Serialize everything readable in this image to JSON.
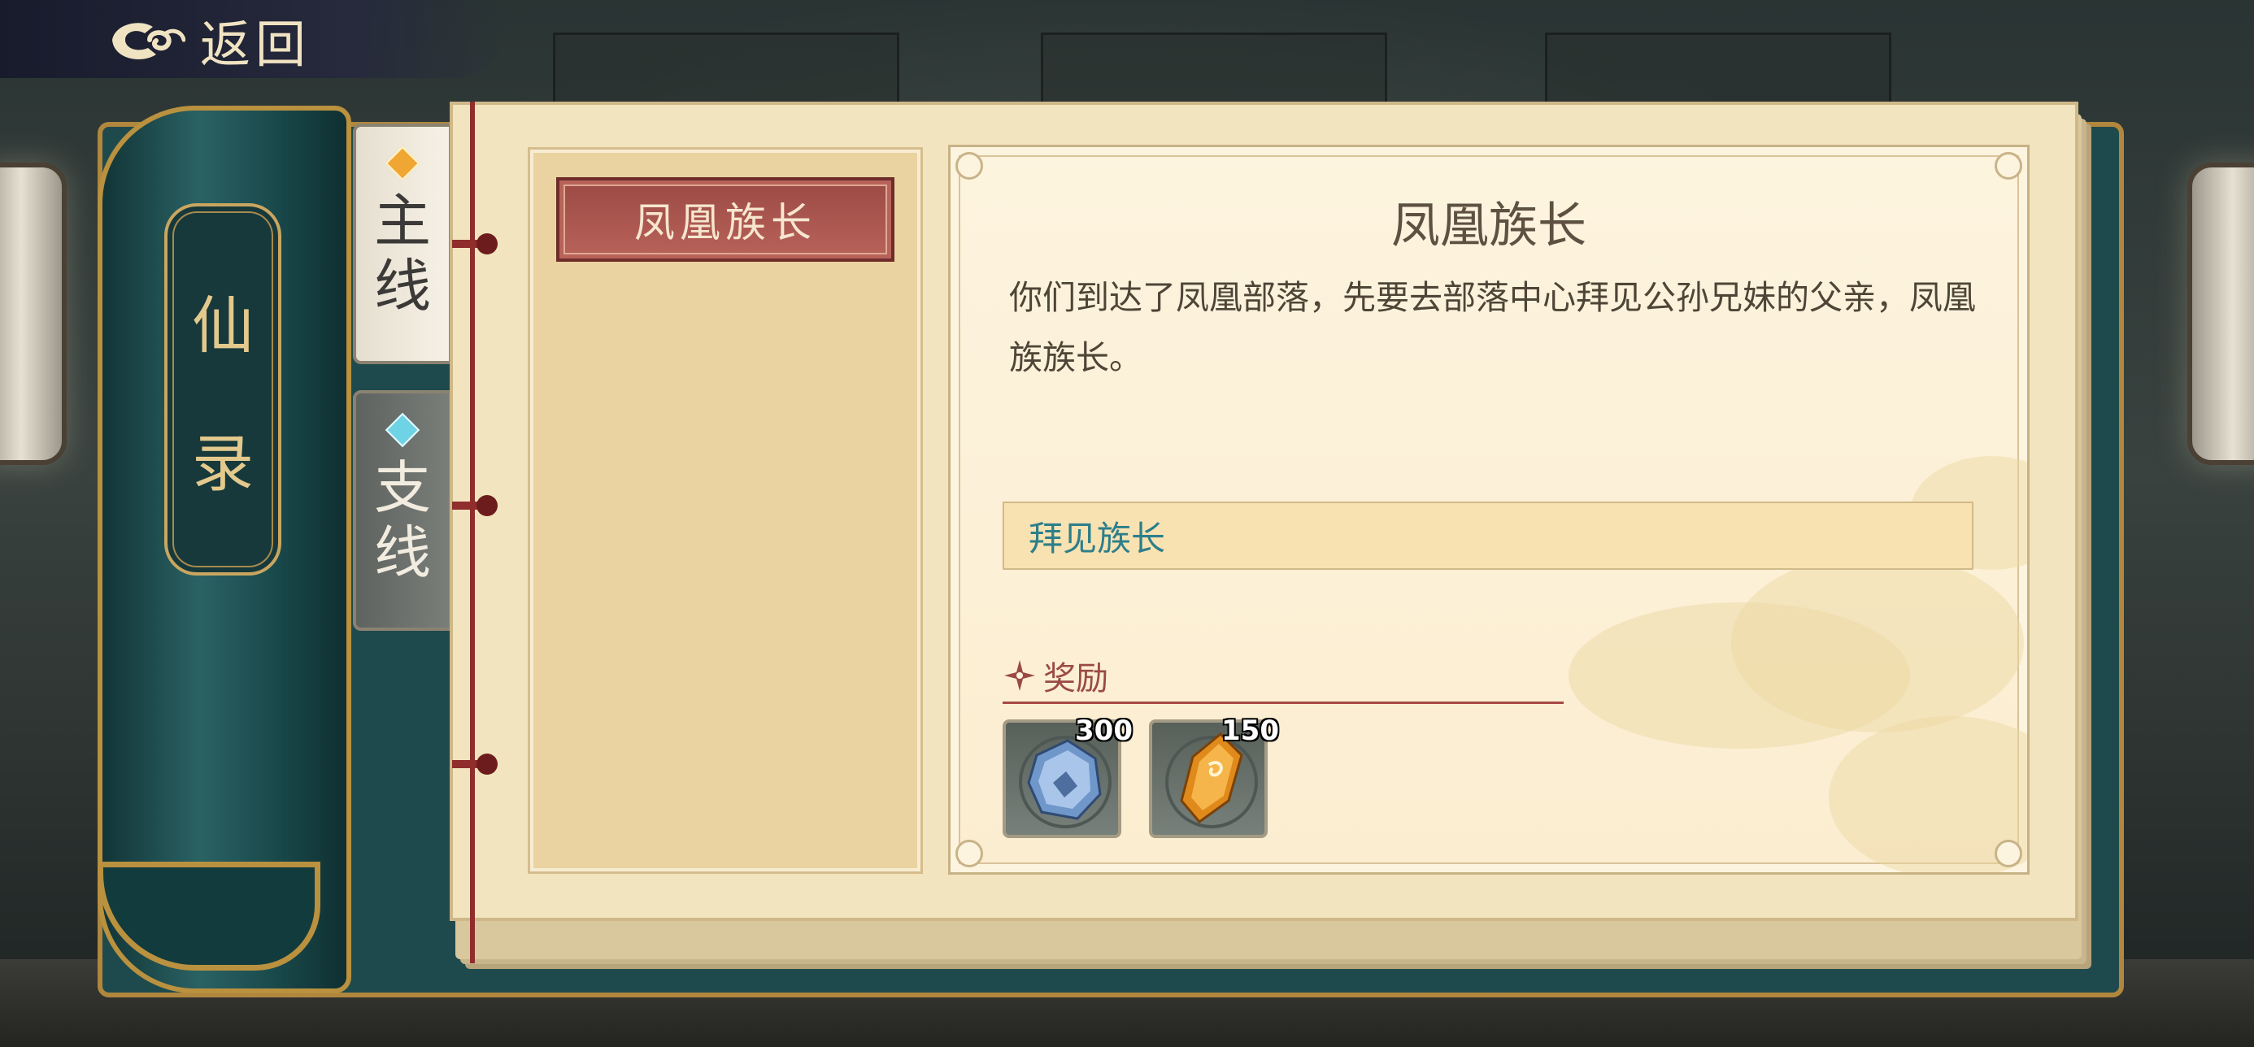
{
  "header": {
    "back_label": "返回"
  },
  "book": {
    "title_chars": [
      "仙",
      "录"
    ]
  },
  "tabs": [
    {
      "chars": [
        "主",
        "线"
      ],
      "state": "active",
      "diamond_color": "#f0a632"
    },
    {
      "chars": [
        "支",
        "线"
      ],
      "state": "inactive",
      "diamond_color": "#6fd3e6"
    }
  ],
  "quest_list": [
    {
      "label": "凤凰族长",
      "selected": true
    }
  ],
  "detail": {
    "title": "凤凰族长",
    "description": "你们到达了凤凰部落，先要去部落中心拜见公孙兄妹的父亲，凤凰族族长。",
    "objective": "拜见族长",
    "reward_label": "奖励",
    "rewards": [
      {
        "icon": "blue-crystal-stone-icon",
        "count": "300"
      },
      {
        "icon": "amber-gem-icon",
        "count": "150"
      }
    ]
  },
  "colors": {
    "accent_red": "#9c4a45",
    "objective_text": "#2c7f8a",
    "cover_teal": "#1f4a4d",
    "gold_trim": "#b9913f"
  }
}
